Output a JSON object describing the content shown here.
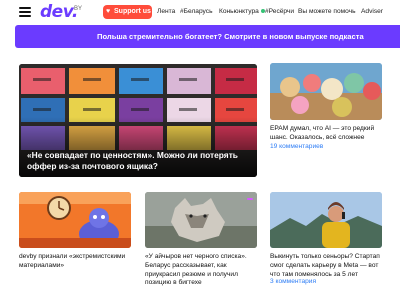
{
  "header": {
    "logo": "dev.",
    "logo_sub": "BY",
    "support_label": "Support us",
    "nav": [
      "Лента",
      "#Беларусь",
      "Коньюнктура",
      "#Ресёрчи",
      "Вы можете помочь",
      "Adviser"
    ]
  },
  "banner": {
    "text": "Польша стремительно богатеет? Смотрите в новом выпуске подкаста"
  },
  "hero": {
    "title": "«Не совпадает по ценностям». Можно ли потерять оффер из-за почтового ящика?"
  },
  "side": {
    "title": "EPAM думал, что AI — это редкий шанс. Оказалось, всё сложнее",
    "comments": "19 комментариев"
  },
  "articles": [
    {
      "title": "devby признали «экстремистскими материалами»",
      "comments": ""
    },
    {
      "title": "«У айчыров нет черного списка». Беларус рассказывает, как приукрасил резюме и получил позицию в бигтехе",
      "comments": ""
    },
    {
      "title": "Выкинуть только сеньоры? Стартап смог сделать карьеру в Meta — вот что там поменялось за 5 лет",
      "comments": "3 комментария"
    }
  ],
  "colors": {
    "brand": "#6b3bff",
    "support": "#ff4c3b",
    "link": "#2f7ef5"
  }
}
